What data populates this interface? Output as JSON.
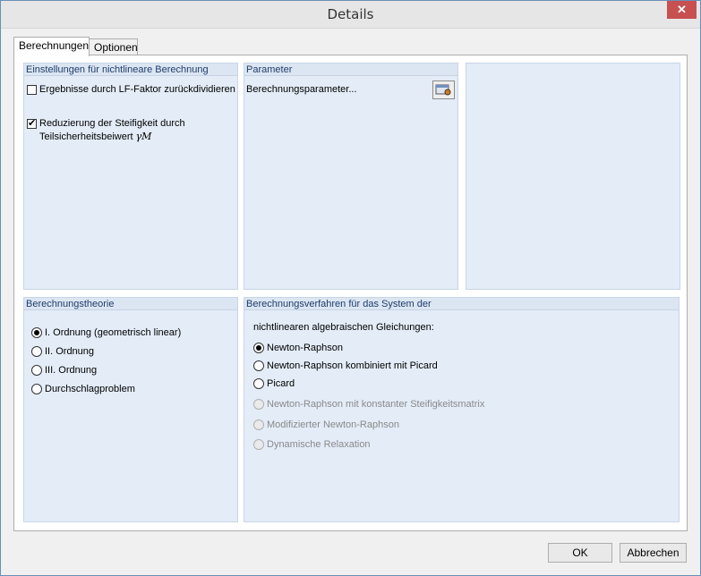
{
  "window": {
    "title": "Details",
    "close_icon": "close-icon"
  },
  "tabs": [
    {
      "label": "Berechnungen",
      "active": true
    },
    {
      "label": "Optionen",
      "active": false
    }
  ],
  "settings": {
    "header": "Einstellungen für nichtlineare Berechnung",
    "option1": {
      "label": "Ergebnisse durch LF-Faktor zurückdividieren",
      "checked": false
    },
    "option2": {
      "label_line1": "Reduzierung der Steifigkeit durch",
      "label_line2": "Teilsicherheitsbeiwert",
      "symbol": "γM",
      "checked": true
    }
  },
  "parameter": {
    "header": "Parameter",
    "label": "Berechnungsparameter...",
    "button_icon": "settings-dialog-icon"
  },
  "theory": {
    "header": "Berechnungstheorie",
    "options": [
      {
        "label": "I. Ordnung (geometrisch linear)",
        "checked": true
      },
      {
        "label": "II. Ordnung",
        "checked": false
      },
      {
        "label": "III. Ordnung",
        "checked": false
      },
      {
        "label": "Durchschlagproblem",
        "checked": false
      }
    ]
  },
  "method": {
    "header": "Berechnungsverfahren für das System der",
    "subheader": "nichtlinearen algebraischen Gleichungen:",
    "options": [
      {
        "label": "Newton-Raphson",
        "checked": true,
        "enabled": true
      },
      {
        "label": "Newton-Raphson kombiniert mit Picard",
        "checked": false,
        "enabled": true
      },
      {
        "label": "Picard",
        "checked": false,
        "enabled": true
      },
      {
        "label": "Newton-Raphson mit konstanter Steifigkeitsmatrix",
        "checked": false,
        "enabled": false
      },
      {
        "label": "Modifizierter Newton-Raphson",
        "checked": false,
        "enabled": false
      },
      {
        "label": "Dynamische Relaxation",
        "checked": false,
        "enabled": false
      }
    ]
  },
  "buttons": {
    "ok": "OK",
    "cancel": "Abbrechen"
  }
}
